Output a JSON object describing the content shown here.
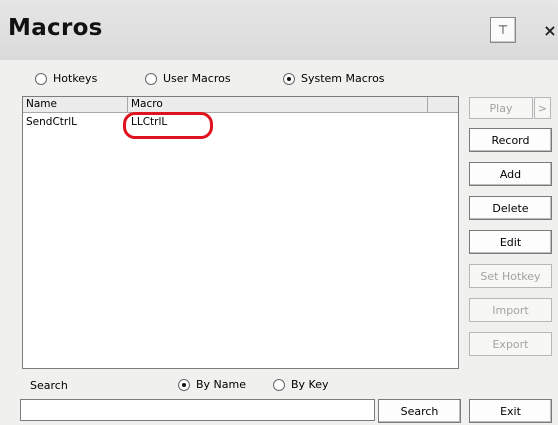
{
  "window": {
    "title": "Macros",
    "pin_label": "⊤",
    "close_label": "×"
  },
  "mode_tabs": [
    {
      "label": "Hotkeys",
      "selected": false
    },
    {
      "label": "User Macros",
      "selected": false
    },
    {
      "label": "System Macros",
      "selected": true
    }
  ],
  "table": {
    "columns": [
      "Name",
      "Macro",
      ""
    ],
    "rows": [
      {
        "name": "SendCtrlL",
        "macro": "LLCtrlL"
      }
    ],
    "highlight_color": "#e0121e"
  },
  "side_buttons": {
    "play": "Play",
    "play_more": ">",
    "record": "Record",
    "add": "Add",
    "delete": "Delete",
    "edit": "Edit",
    "set_hotkey": "Set Hotkey",
    "import": "Import",
    "export": "Export",
    "exit": "Exit"
  },
  "search": {
    "label": "Search",
    "by_name": "By Name",
    "by_key": "By Key",
    "by_name_selected": true,
    "value": "",
    "button": "Search"
  }
}
